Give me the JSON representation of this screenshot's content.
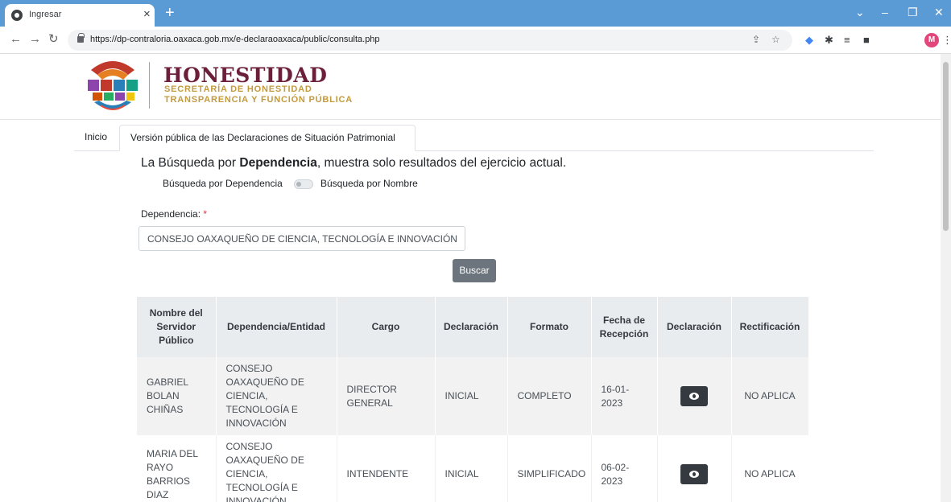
{
  "browser": {
    "tab_title": "Ingresar",
    "url": "https://dp-contraloria.oaxaca.gob.mx/e-declaraoaxaca/public/consulta.php",
    "profile_initial": "M"
  },
  "header": {
    "brand_title": "HONESTIDAD",
    "brand_line1": "SECRETARÍA DE HONESTIDAD",
    "brand_line2": "TRANSPARENCIA Y FUNCIÓN PÚBLICA"
  },
  "nav": {
    "tab_home": "Inicio",
    "tab_active": "Versión pública de las Declaraciones de Situación Patrimonial"
  },
  "search": {
    "notice_prefix": "La Búsqueda por ",
    "notice_bold": "Dependencia",
    "notice_suffix": ", muestra solo resultados del ejercicio actual.",
    "toggle_left": "Búsqueda por Dependencia",
    "toggle_right": "Búsqueda por Nombre",
    "field_label": "Dependencia:",
    "required_mark": "*",
    "selected_value": "CONSEJO OAXAQUEÑO DE CIENCIA, TECNOLOGÍA E INNOVACIÓN",
    "button_label": "Buscar"
  },
  "table": {
    "headers": [
      "Nombre del Servidor Público",
      "Dependencia/Entidad",
      "Cargo",
      "Declaración",
      "Formato",
      "Fecha de Recepción",
      "Declaración",
      "Rectificación"
    ],
    "rows": [
      {
        "nombre": "GABRIEL BOLAN CHIÑAS",
        "dependencia": "CONSEJO OAXAQUEÑO DE CIENCIA, TECNOLOGÍA E INNOVACIÓN",
        "cargo": "DIRECTOR GENERAL",
        "declaracion": "INICIAL",
        "formato": "COMPLETO",
        "fecha": "16-01-2023",
        "rectificacion": "NO APLICA"
      },
      {
        "nombre": "MARIA DEL RAYO BARRIOS DIAZ",
        "dependencia": "CONSEJO OAXAQUEÑO DE CIENCIA, TECNOLOGÍA E INNOVACIÓN",
        "cargo": "INTENDENTE",
        "declaracion": "INICIAL",
        "formato": "SIMPLIFICADO",
        "fecha": "06-02-2023",
        "rectificacion": "NO APLICA"
      }
    ]
  },
  "colors": {
    "brand_primary": "#6b1f3a",
    "brand_gold": "#c39a3c",
    "button_secondary": "#6c757d",
    "tabstrip": "#5a9bd5"
  }
}
